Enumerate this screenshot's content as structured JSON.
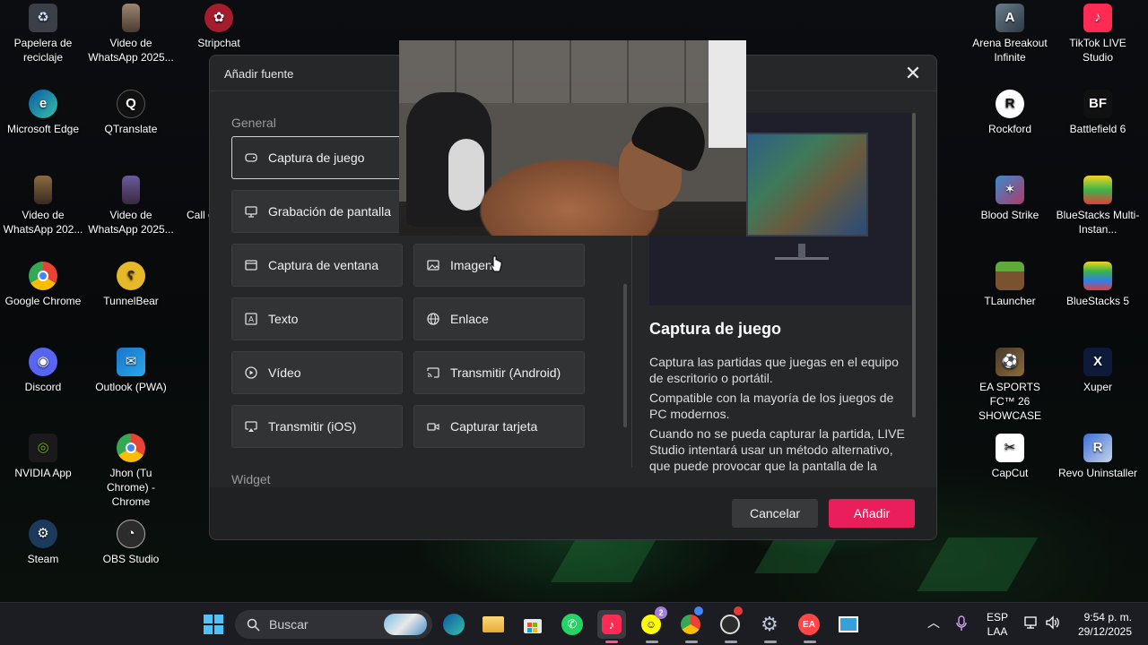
{
  "desktop_icons_left": [
    {
      "label": "Papelera de reciclaje",
      "icon": "recycle-bin-icon"
    },
    {
      "label": "Microsoft Edge",
      "icon": "edge-icon"
    },
    {
      "label": "Video de WhatsApp 202...",
      "icon": "video-file-icon"
    },
    {
      "label": "Google Chrome",
      "icon": "chrome-icon"
    },
    {
      "label": "Discord",
      "icon": "discord-icon"
    },
    {
      "label": "NVIDIA App",
      "icon": "nvidia-icon"
    },
    {
      "label": "Steam",
      "icon": "steam-icon"
    }
  ],
  "desktop_icons_left2": [
    {
      "label": "Video de WhatsApp 2025...",
      "icon": "video-file-icon"
    },
    {
      "label": "QTranslate",
      "icon": "qtranslate-icon"
    },
    {
      "label": "Video de WhatsApp 2025...",
      "icon": "video-file-icon"
    },
    {
      "label": "TunnelBear",
      "icon": "tunnelbear-icon"
    },
    {
      "label": "Outlook (PWA)",
      "icon": "outlook-icon"
    },
    {
      "label": "Jhon (Tu Chrome) - Chrome",
      "icon": "chrome-profile-icon"
    },
    {
      "label": "OBS Studio",
      "icon": "obs-icon"
    }
  ],
  "desktop_icons_col3": [
    {
      "label": "Stripchat",
      "icon": "stripchat-icon"
    },
    {
      "label": "Call o",
      "icon": "call-icon"
    }
  ],
  "desktop_icons_right1": [
    {
      "label": "Arena Breakout Infinite",
      "icon": "arena-breakout-icon"
    },
    {
      "label": "Rockford",
      "icon": "rockford-icon"
    },
    {
      "label": "Blood Strike",
      "icon": "blood-strike-icon"
    },
    {
      "label": "TLauncher",
      "icon": "tlauncher-icon"
    },
    {
      "label": "EA SPORTS FC™ 26 SHOWCASE",
      "icon": "ea-fc-icon"
    },
    {
      "label": "CapCut",
      "icon": "capcut-icon"
    }
  ],
  "desktop_icons_right2": [
    {
      "label": "TikTok LIVE Studio",
      "icon": "tiktok-live-icon"
    },
    {
      "label": "Battlefield 6",
      "icon": "battlefield-icon"
    },
    {
      "label": "BlueStacks Multi-Instan...",
      "icon": "bluestacks-multi-icon"
    },
    {
      "label": "BlueStacks 5",
      "icon": "bluestacks-icon"
    },
    {
      "label": "Xuper",
      "icon": "xuper-icon"
    },
    {
      "label": "Revo Uninstaller",
      "icon": "revo-icon"
    }
  ],
  "dialog": {
    "title": "Añadir fuente",
    "close_glyph": "✕",
    "section_general": "General",
    "section_widget": "Widget",
    "options": [
      {
        "label": "Captura de juego",
        "icon": "gamepad-icon",
        "selected": true
      },
      {
        "label": "Grabación de pantalla",
        "icon": "monitor-icon"
      },
      {
        "label": "Captura de ventana",
        "icon": "window-icon"
      },
      {
        "label": "Imagen",
        "icon": "image-icon"
      },
      {
        "label": "Texto",
        "icon": "text-icon"
      },
      {
        "label": "Enlace",
        "icon": "globe-icon"
      },
      {
        "label": "Vídeo",
        "icon": "play-icon"
      },
      {
        "label": "Transmitir (Android)",
        "icon": "cast-icon"
      },
      {
        "label": "Transmitir (iOS)",
        "icon": "airplay-icon"
      },
      {
        "label": "Capturar tarjeta",
        "icon": "camera-icon"
      }
    ],
    "desc_title": "Captura de juego",
    "desc_paragraphs": [
      "Captura las partidas que juegas en el equipo de escritorio o portátil.",
      "Compatible con la mayoría de los juegos de PC modernos.",
      "Cuando no se pueda capturar la partida, LIVE Studio intentará usar un método alternativo, que puede provocar que la pantalla de la partida aparezca con un marco amarillo que"
    ],
    "cancel_label": "Cancelar",
    "add_label": "Añadir"
  },
  "taskbar": {
    "search_placeholder": "Buscar",
    "apps": [
      "start",
      "edge",
      "file-explorer",
      "microsoft-store",
      "whatsapp",
      "tiktok-live-studio",
      "snapchat",
      "chrome",
      "obs",
      "settings",
      "ea",
      "app"
    ],
    "snap_badge": "2",
    "lang_top": "ESP",
    "lang_bottom": "LAA",
    "time": "9:54 p. m.",
    "date": "29/12/2025"
  },
  "colors": {
    "accent": "#e91e5a",
    "dialog_bg": "#262729"
  }
}
